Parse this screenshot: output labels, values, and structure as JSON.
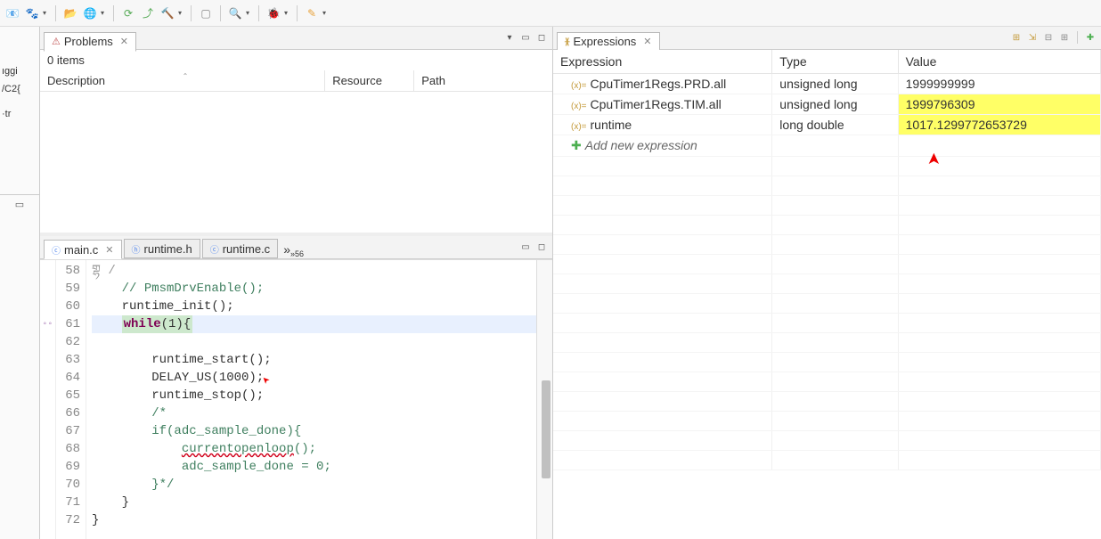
{
  "toolbar": {
    "icons": [
      "📧",
      "🍲",
      "🧭",
      "🐞",
      "🔄",
      "🔙",
      "🔨",
      "📋",
      "🔍",
      "🐞",
      "🖊"
    ]
  },
  "left_strip": {
    "items": [
      "ıggi",
      "/C2{",
      "",
      "·tr"
    ]
  },
  "problems": {
    "title": "Problems",
    "count_text": "0 items",
    "columns": [
      "Description",
      "Resource",
      "Path"
    ]
  },
  "editor": {
    "tabs": [
      {
        "label": "main.c",
        "active": true,
        "icon": "c"
      },
      {
        "label": "runtime.h",
        "active": false,
        "icon": "h"
      },
      {
        "label": "runtime.c",
        "active": false,
        "icon": "c"
      }
    ],
    "more_label": "»56",
    "lines": [
      {
        "n": 58,
        "raw": "གྷ /"
      },
      {
        "n": 59,
        "raw": "    // PmsmDrvEnable();"
      },
      {
        "n": 60,
        "raw": "    runtime_init();"
      },
      {
        "n": 61,
        "raw": "    while(1){"
      },
      {
        "n": 62,
        "raw": ""
      },
      {
        "n": 63,
        "raw": "        runtime_start();"
      },
      {
        "n": 64,
        "raw": "        DELAY_US(1000);"
      },
      {
        "n": 65,
        "raw": "        runtime_stop();"
      },
      {
        "n": 66,
        "raw": "        /*"
      },
      {
        "n": 67,
        "raw": "        if(adc_sample_done){"
      },
      {
        "n": 68,
        "raw": "            currentopenloop();"
      },
      {
        "n": 69,
        "raw": "            adc_sample_done = 0;"
      },
      {
        "n": 70,
        "raw": "        }*/"
      },
      {
        "n": 71,
        "raw": "    }"
      },
      {
        "n": 72,
        "raw": "}"
      }
    ]
  },
  "expressions": {
    "title": "Expressions",
    "columns": [
      "Expression",
      "Type",
      "Value"
    ],
    "rows": [
      {
        "name": "CpuTimer1Regs.PRD.all",
        "type": "unsigned long",
        "value": "1999999999",
        "highlight": false
      },
      {
        "name": "CpuTimer1Regs.TIM.all",
        "type": "unsigned long",
        "value": "1999796309",
        "highlight": true
      },
      {
        "name": "runtime",
        "type": "long double",
        "value": "1017.1299772653729",
        "highlight": true
      }
    ],
    "add_label": "Add new expression"
  }
}
